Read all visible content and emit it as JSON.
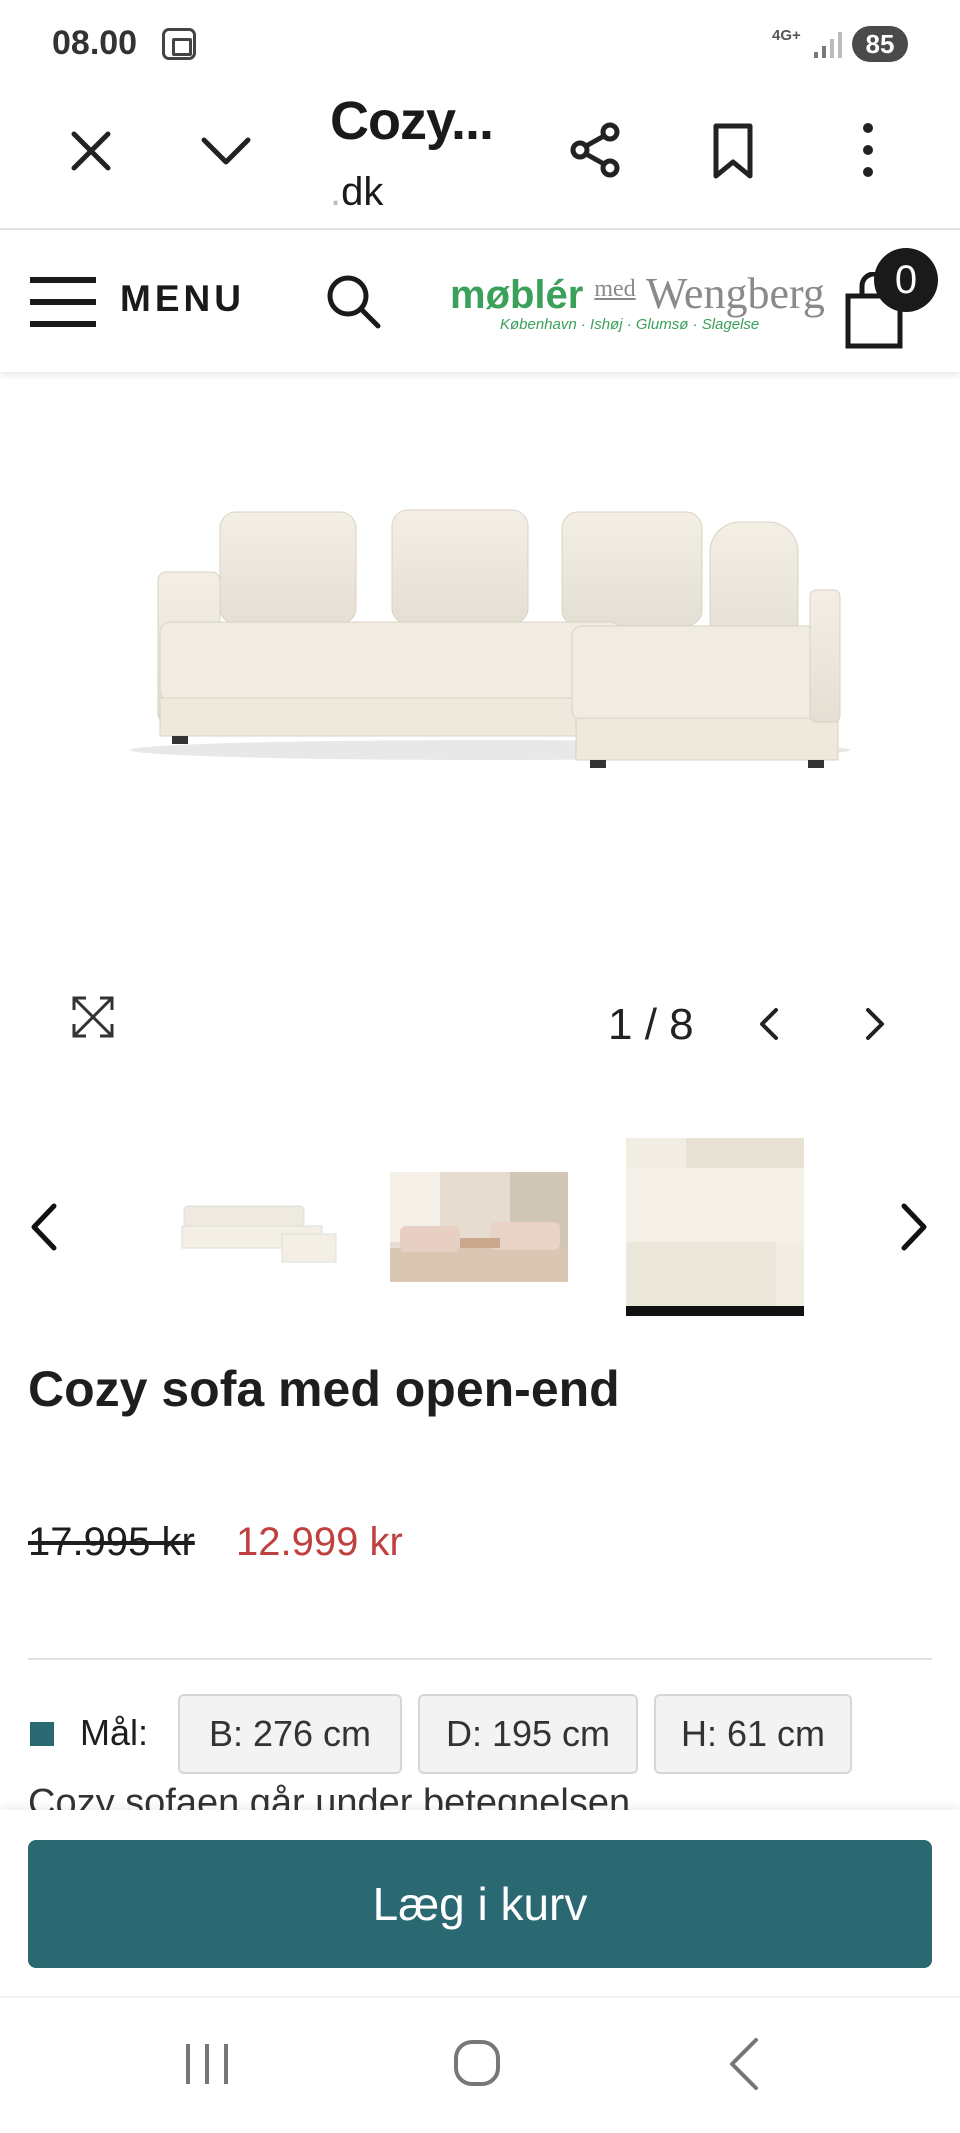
{
  "status_bar": {
    "time": "08.00",
    "network": "4G+",
    "battery": "85"
  },
  "browser": {
    "title": "Cozy...",
    "domain_prefix": ".",
    "domain": "dk"
  },
  "shop_header": {
    "menu_label": "MENU",
    "logo": {
      "part1": "møblér",
      "part2": "med",
      "part3": "Wengberg",
      "subtitle": "København · Ishøj · Glumsø · Slagelse"
    },
    "cart_count": "0"
  },
  "gallery": {
    "counter": "1 / 8"
  },
  "product": {
    "title": "Cozy sofa med open-end",
    "price_old": "17.995 kr",
    "price_new": "12.999 kr",
    "dims_label": "Mål:",
    "dims": [
      "B: 276 cm",
      "D: 195 cm",
      "H: 61 cm"
    ],
    "description": "Cozy sofaen går under betegnelsen",
    "add_to_cart": "Læg i kurv"
  },
  "colors": {
    "accent": "#2a6872",
    "sale": "#c0403f",
    "logo_green": "#3aa05a"
  }
}
